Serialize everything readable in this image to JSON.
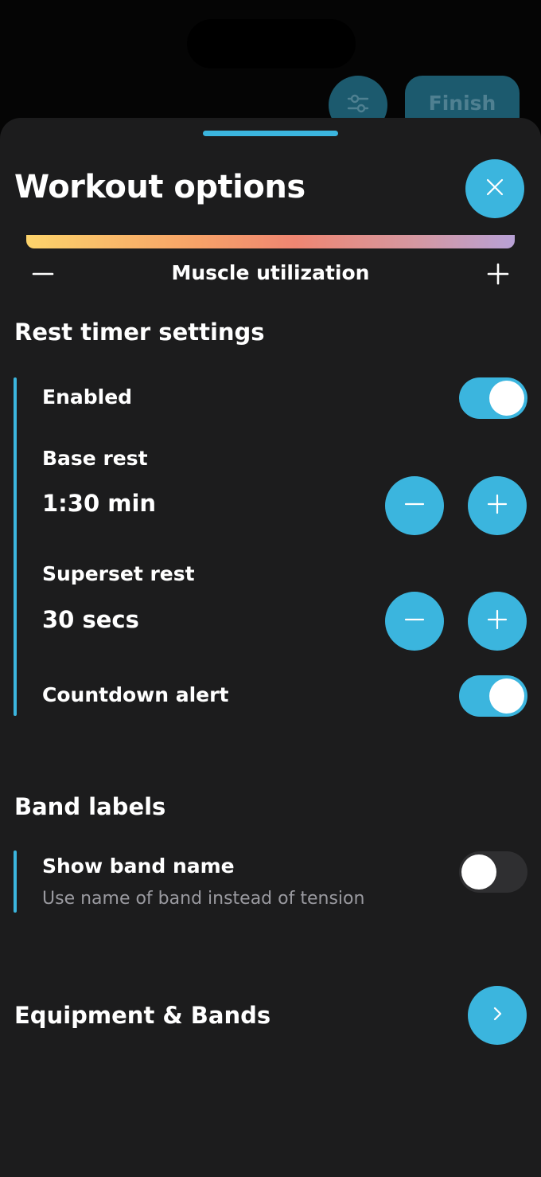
{
  "header": {
    "finish_label": "Finish",
    "filter_icon": "sliders-icon"
  },
  "sheet": {
    "title": "Workout options",
    "close_icon": "close-icon"
  },
  "muscle_utilization": {
    "label": "Muscle utilization",
    "gradient_colors": [
      "#fcd36b",
      "#f7a268",
      "#ef8672",
      "#d598a2",
      "#b8a1d6"
    ]
  },
  "rest_timer": {
    "heading": "Rest timer settings",
    "enabled_label": "Enabled",
    "enabled": true,
    "base_rest_label": "Base rest",
    "base_rest_value": "1:30 min",
    "superset_rest_label": "Superset rest",
    "superset_rest_value": "30 secs",
    "countdown_alert_label": "Countdown alert",
    "countdown_alert": true
  },
  "band_labels": {
    "heading": "Band labels",
    "show_band_name_label": "Show band name",
    "show_band_name_description": "Use name of band instead of tension",
    "show_band_name": false
  },
  "equipment": {
    "label": "Equipment & Bands",
    "chevron_icon": "chevron-right-icon"
  },
  "colors": {
    "accent": "#3bb5de",
    "sheet_background": "#1c1c1d",
    "muted_text": "#9a9aa0"
  }
}
